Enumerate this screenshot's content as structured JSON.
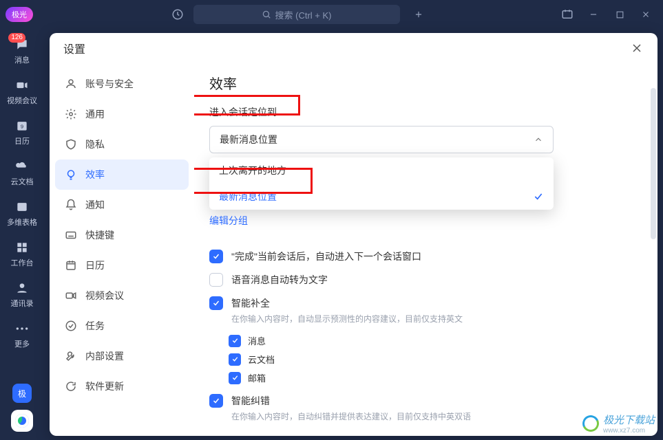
{
  "titlebar": {
    "logo": "极光",
    "search_placeholder": "搜索 (Ctrl + K)"
  },
  "navrail": {
    "items": [
      {
        "label": "消息",
        "badge": "126"
      },
      {
        "label": "视频会议"
      },
      {
        "label": "日历"
      },
      {
        "label": "云文档"
      },
      {
        "label": "多维表格"
      },
      {
        "label": "工作台"
      },
      {
        "label": "通讯录"
      },
      {
        "label": "更多"
      }
    ],
    "bottom_label": "极"
  },
  "panel": {
    "title": "设置"
  },
  "setnav": {
    "items": [
      {
        "label": "账号与安全"
      },
      {
        "label": "通用"
      },
      {
        "label": "隐私"
      },
      {
        "label": "效率"
      },
      {
        "label": "通知"
      },
      {
        "label": "快捷键"
      },
      {
        "label": "日历"
      },
      {
        "label": "视频会议"
      },
      {
        "label": "任务"
      },
      {
        "label": "内部设置"
      },
      {
        "label": "软件更新"
      }
    ]
  },
  "content": {
    "heading": "效率",
    "section_label": "进入会话定位到",
    "select_value": "最新消息位置",
    "dropdown": {
      "opt0": "上次离开的地方",
      "opt1": "最新消息位置"
    },
    "link_edit_group": "编辑分组",
    "row_done_next": "\"完成\"当前会话后，自动进入下一个会话窗口",
    "row_voice_to_text": "语音消息自动转为文字",
    "row_smart_complete": "智能补全",
    "row_smart_complete_desc": "在你输入内容时，自动显示预测性的内容建议，目前仅支持英文",
    "sub_messages": "消息",
    "sub_docs": "云文档",
    "sub_mail": "邮箱",
    "row_smart_correct": "智能纠错",
    "row_smart_correct_desc": "在你输入内容时，自动纠错并提供表达建议，目前仅支持中英双语"
  },
  "watermark": {
    "brand": "极光下载站",
    "url": "www.xz7.com"
  }
}
